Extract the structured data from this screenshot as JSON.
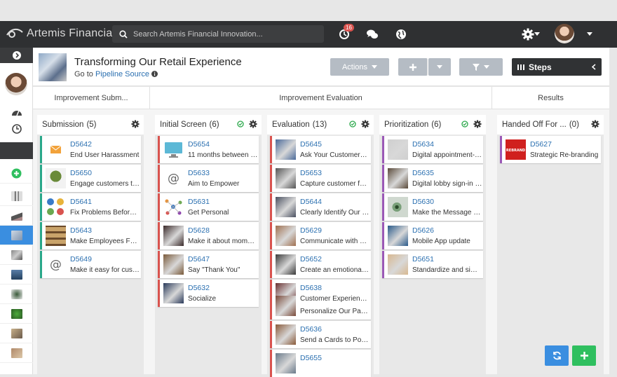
{
  "app": {
    "name": "Artemis Financial"
  },
  "search": {
    "placeholder": "Search Artemis Financial Innovation..."
  },
  "notifications": {
    "count": "16"
  },
  "page": {
    "title": "Transforming Our Retail Experience",
    "goto_prefix": "Go to",
    "goto_link": "Pipeline Source"
  },
  "toolbar": {
    "actions_label": "Actions",
    "steps_label": "Steps"
  },
  "groups": [
    "Improvement Subm...",
    "Improvement Evaluation",
    "Results"
  ],
  "columns": [
    {
      "name": "Submission",
      "count": "(5)",
      "accent": "#2aa88a",
      "cards": [
        {
          "id": "D5642",
          "title": "End User Harassment",
          "icon": "envelope-icon",
          "color": "#f2a23a"
        },
        {
          "id": "D5650",
          "title": "Engage customers thro...",
          "icon": "tree-icon",
          "color": "#8a6b3e"
        },
        {
          "id": "D5641",
          "title": "Fix Problems Before Th...",
          "icon": "dots-icon",
          "color": "#6aa84f"
        },
        {
          "id": "D5643",
          "title": "Make Employees Famo...",
          "icon": "shelves-icon",
          "color": "#8b6a3a"
        },
        {
          "id": "D5649",
          "title": "Make it easy for custo...",
          "icon": "at-icon",
          "color": "#eeeeee"
        }
      ]
    },
    {
      "name": "Initial Screen",
      "count": "(6)",
      "accent": "#d9534f",
      "cards": [
        {
          "id": "D5654",
          "title": "11 months between th...",
          "icon": "monitor-icon",
          "color": "#5cb8d6"
        },
        {
          "id": "D5633",
          "title": "Aim to Empower",
          "icon": "at-icon",
          "color": "#eeeeee"
        },
        {
          "id": "D5631",
          "title": "Get Personal",
          "icon": "network-icon",
          "color": "#e8eef5"
        },
        {
          "id": "D5628",
          "title": "Make it about moments",
          "icon": "photo-icon",
          "color": "#3a2a2a"
        },
        {
          "id": "D5647",
          "title": "Say \"Thank You\"",
          "icon": "photo-icon",
          "color": "#7a5a3a"
        },
        {
          "id": "D5632",
          "title": "Socialize",
          "icon": "photo-icon",
          "color": "#2a3a5a"
        }
      ]
    },
    {
      "name": "Evaluation",
      "count": "(13)",
      "accent": "#d9534f",
      "cards": [
        {
          "id": "D5645",
          "title": "Ask Your Customers Q...",
          "icon": "photo-icon",
          "color": "#4a6a9a"
        },
        {
          "id": "D5653",
          "title": "Capture customer feed...",
          "icon": "photo-icon",
          "color": "#555555"
        },
        {
          "id": "D5644",
          "title": "Clearly Identify Our Cu...",
          "icon": "photo-icon",
          "color": "#4a5060"
        },
        {
          "id": "D5629",
          "title": "Communicate with vid...",
          "icon": "photo-icon",
          "color": "#a07050"
        },
        {
          "id": "D5652",
          "title": "Create an emotional co...",
          "icon": "photo-icon",
          "color": "#3a3a3a"
        },
        {
          "id": "D5638",
          "title": "Customer Experience A...",
          "icon": "photo-icon",
          "color": "#6a3030",
          "extra": "Personalize Our Packa..."
        },
        {
          "id": "D5636",
          "title": "Send a Cards to Power...",
          "icon": "photo-icon",
          "color": "#8a5a3a"
        },
        {
          "id": "D5655",
          "title": "",
          "icon": "photo-icon",
          "color": "#6a7a8a"
        }
      ]
    },
    {
      "name": "Prioritization",
      "count": "(6)",
      "accent": "#9b59b6",
      "cards": [
        {
          "id": "D5634",
          "title": "Digital appointment-se...",
          "icon": "photo-icon",
          "color": "#cfcfcf"
        },
        {
          "id": "D5635",
          "title": "Digital lobby sign-in sy...",
          "icon": "photo-icon",
          "color": "#5a4a3a"
        },
        {
          "id": "D5630",
          "title": "Make the Message Visu...",
          "icon": "eye-icon",
          "color": "#7aa07a"
        },
        {
          "id": "D5626",
          "title": "Mobile App update",
          "icon": "photo-icon",
          "color": "#2a5a8a"
        },
        {
          "id": "D5651",
          "title": "Standardize and simpli...",
          "icon": "photo-icon",
          "color": "#d8b890"
        }
      ]
    },
    {
      "name": "Handed Off For ...",
      "count": "(0)",
      "accent": "#9b59b6",
      "cards": [
        {
          "id": "D5627",
          "title": "Strategic Re-branding",
          "icon": "rebrand-icon",
          "color": "#d0201e",
          "img_text": "REBRAND"
        }
      ]
    }
  ],
  "colors": {
    "topbar": "#2f3032",
    "link": "#2a6fb0",
    "refresh_button": "#3a8ee0",
    "add_button": "#2fbf5f"
  }
}
